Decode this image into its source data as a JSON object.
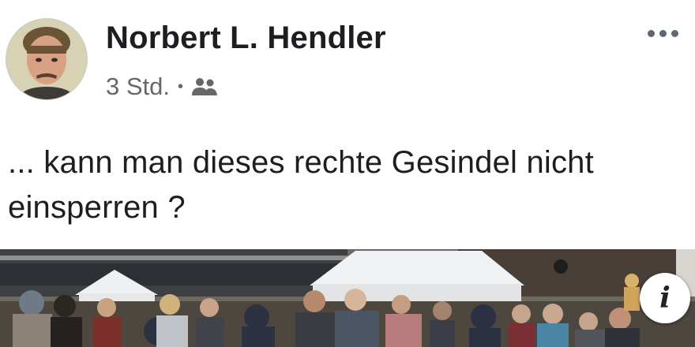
{
  "post": {
    "author": "Norbert L. Hendler",
    "time": "3 Std.",
    "separator": "•",
    "audience_icon": "group-icon",
    "more_icon": "more-horizontal-icon",
    "text_line1": "... kann man dieses rechte Gesindel nicht",
    "text_line2": "einsperren ?",
    "info_icon": "info-icon",
    "info_glyph": "i"
  }
}
